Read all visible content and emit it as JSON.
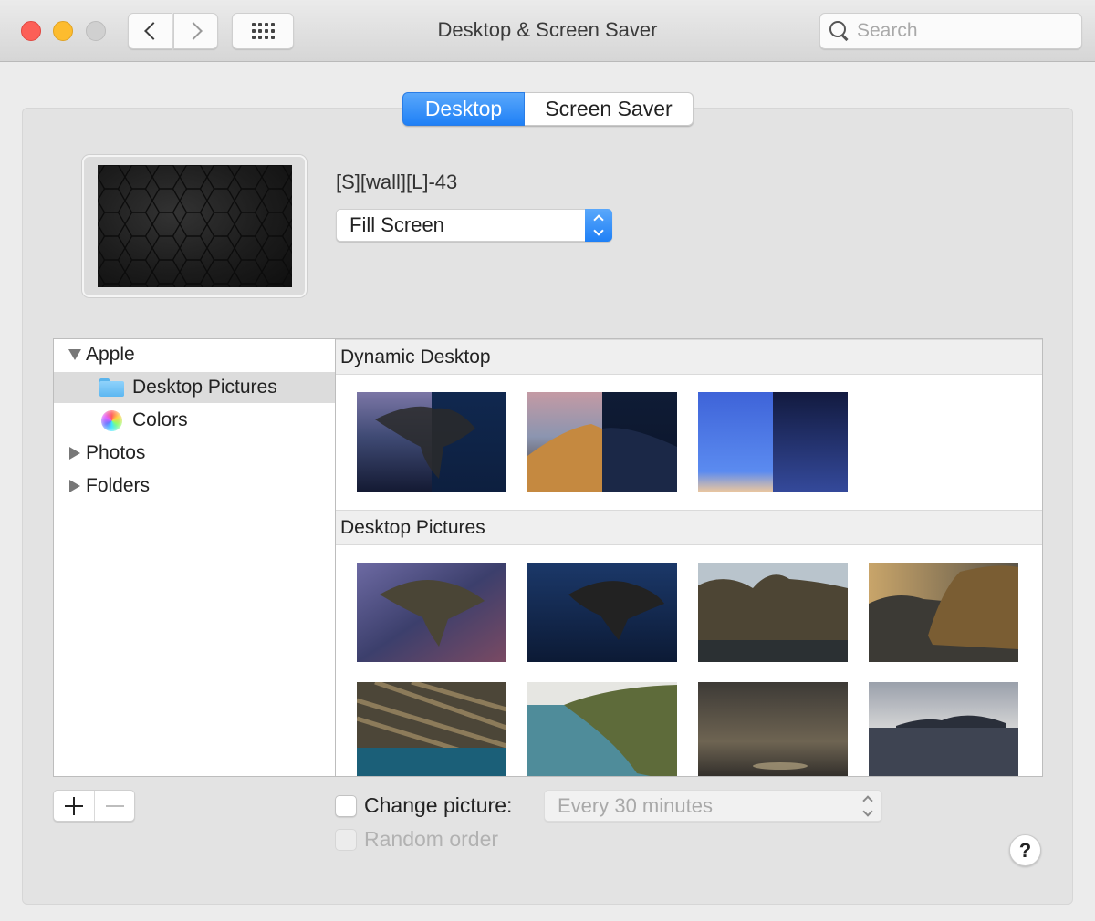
{
  "window": {
    "title": "Desktop & Screen Saver",
    "controls": {
      "close": "close",
      "minimize": "minimize",
      "zoom": "zoom"
    },
    "nav": {
      "back_icon": "chevron-left-icon",
      "forward_icon": "chevron-right-icon",
      "grid_icon": "show-all-grid-icon"
    },
    "search": {
      "placeholder": "Search",
      "value": ""
    }
  },
  "tabs": [
    {
      "label": "Desktop",
      "active": true
    },
    {
      "label": "Screen Saver",
      "active": false
    }
  ],
  "current": {
    "wallpaper_name": "[S][wall][L]-43",
    "fit_mode": "Fill Screen"
  },
  "sidebar": {
    "items": [
      {
        "label": "Apple",
        "expanded": true,
        "icon": "disclosure-down-icon"
      },
      {
        "label": "Desktop Pictures",
        "selected": true,
        "icon": "folder-icon"
      },
      {
        "label": "Colors",
        "icon": "color-wheel-icon"
      },
      {
        "label": "Photos",
        "expanded": false,
        "icon": "disclosure-right-icon"
      },
      {
        "label": "Folders",
        "expanded": false,
        "icon": "disclosure-right-icon"
      }
    ]
  },
  "gallery": {
    "sections": [
      {
        "title": "Dynamic Desktop",
        "thumbnails": [
          {
            "name": "catalina-dynamic",
            "day": "#6b6f9c",
            "night": "#0f2a52"
          },
          {
            "name": "mojave-dynamic",
            "day": "#c98b45",
            "night": "#15213d"
          },
          {
            "name": "solar-gradients",
            "day": "#4b72e0",
            "night": "#141c45"
          }
        ]
      },
      {
        "title": "Desktop Pictures",
        "thumbnails": [
          {
            "name": "catalina-evening"
          },
          {
            "name": "catalina-night"
          },
          {
            "name": "catalina-cliffs"
          },
          {
            "name": "catalina-sunset-cliff"
          },
          {
            "name": "catalina-rock-strata"
          },
          {
            "name": "catalina-coastline"
          },
          {
            "name": "catalina-stormy-sea"
          },
          {
            "name": "catalina-clouds-island"
          }
        ]
      }
    ]
  },
  "footer": {
    "add_label": "+",
    "remove_label": "—",
    "change_picture": {
      "label": "Change picture:",
      "checked": false
    },
    "interval": {
      "value": "Every 30 minutes",
      "enabled": false
    },
    "random_order": {
      "label": "Random order",
      "checked": false,
      "enabled": false
    },
    "help_label": "?"
  },
  "colors": {
    "accent": "#1f80f6",
    "close": "#fc5f57",
    "minimize": "#fdbc2e",
    "zoom_disabled": "#d0d0d0"
  }
}
